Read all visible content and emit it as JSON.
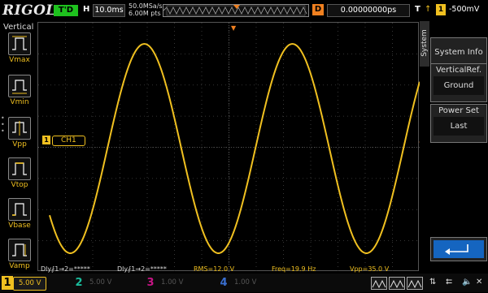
{
  "topbar": {
    "logo": "RIGOL",
    "status": "T'D",
    "h_label": "H",
    "timebase": "10.0ms",
    "sample_rate": "50.0MSa/s",
    "memory_depth": "6.00M pts",
    "d_label": "D",
    "trigger_delay": "0.00000000ps",
    "t_label": "T",
    "trigger_source": "1",
    "trigger_level": "-500mV"
  },
  "left_panel": {
    "title": "Vertical",
    "items": [
      {
        "label": "Vmax",
        "icon": "vmax-icon"
      },
      {
        "label": "Vmin",
        "icon": "vmin-icon"
      },
      {
        "label": "Vpp",
        "icon": "vpp-icon"
      },
      {
        "label": "Vtop",
        "icon": "vtop-icon"
      },
      {
        "label": "Vbase",
        "icon": "vbase-icon"
      },
      {
        "label": "Vamp",
        "icon": "vamp-icon"
      }
    ]
  },
  "screen": {
    "channel_label": "CH1",
    "channel_marker": "1",
    "waveform": {
      "type": "sine",
      "cycles_visible": 2.5,
      "color": "#f0c020"
    }
  },
  "measurements": {
    "dly1": "Dly⨏1→2=*****",
    "dly2": "Dly⨏1→2=*****",
    "rms": "RMS=12.0 V",
    "freq": "Freq=19.9 Hz",
    "vpp": "Vpp=35.0 V"
  },
  "right_menu": {
    "tab": "System",
    "system_info": "System Info",
    "vertical_ref_header": "VerticalRef.",
    "vertical_ref_value": "Ground",
    "power_set_header": "Power Set",
    "power_set_value": "Last"
  },
  "bottombar": {
    "ch1": {
      "num": "1",
      "scale": "5.00 V"
    },
    "ch2": {
      "num": "2",
      "scale": "5.00 V"
    },
    "ch3": {
      "num": "3",
      "scale": "1.00 V"
    },
    "ch4": {
      "num": "4",
      "scale": "1.00 V"
    }
  },
  "colors": {
    "ch1": "#f0c020",
    "ch2": "#1abc9c",
    "ch3": "#c71585",
    "ch4": "#3a6fd0",
    "trigger": "#f08020",
    "status_green": "#1ec21e",
    "menu_blue": "#1565c0"
  }
}
